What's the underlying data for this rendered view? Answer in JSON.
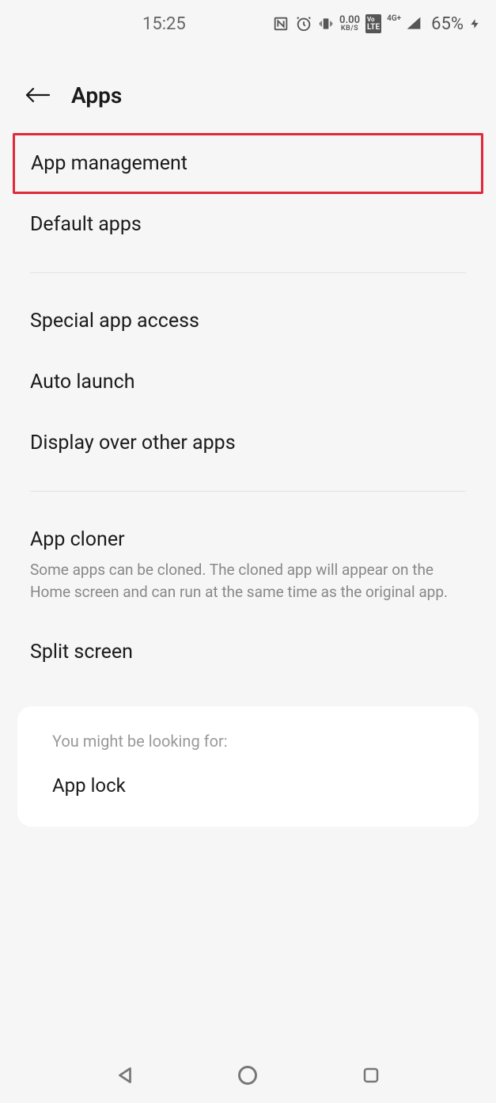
{
  "status": {
    "time": "15:25",
    "data_rate_value": "0.00",
    "data_rate_unit": "KB/S",
    "lte_top": "Vo",
    "lte_bottom": "LTE",
    "signal_label": "4G+",
    "battery": "65%"
  },
  "header": {
    "title": "Apps"
  },
  "items": {
    "app_management": "App management",
    "default_apps": "Default apps",
    "special_access": "Special app access",
    "auto_launch": "Auto launch",
    "display_over": "Display over other apps",
    "app_cloner": "App cloner",
    "app_cloner_desc": "Some apps can be cloned. The cloned app will appear on the Home screen and can run at the same time as the original app.",
    "split_screen": "Split screen"
  },
  "suggest": {
    "label": "You might be looking for:",
    "item": "App lock"
  }
}
